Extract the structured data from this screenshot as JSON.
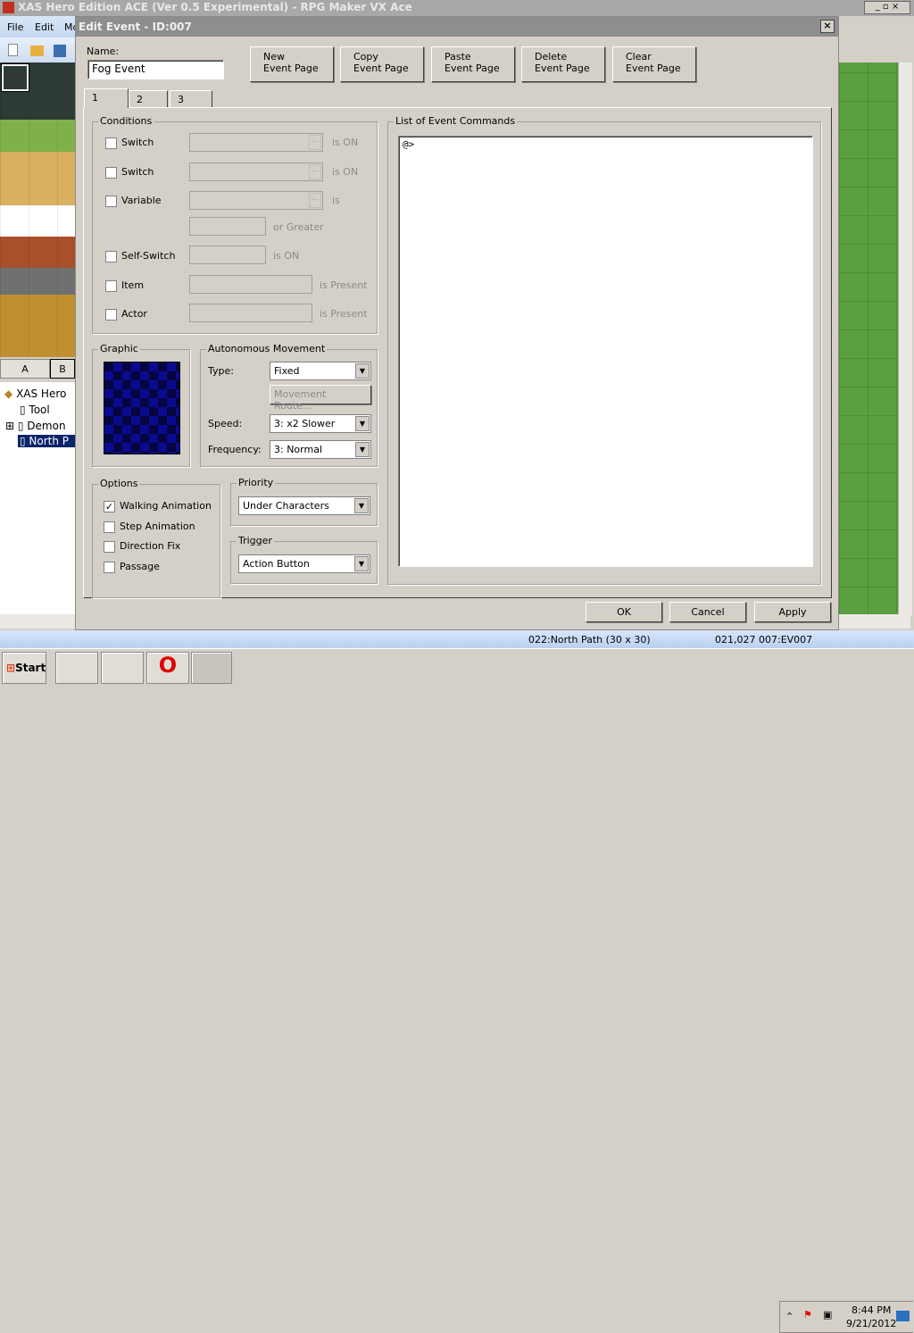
{
  "app": {
    "title": "XAS Hero Edition ACE (Ver 0.5 Experimental) - RPG Maker VX Ace",
    "menu": [
      "File",
      "Edit",
      "Mo"
    ]
  },
  "palette_tabs": [
    "A",
    "B"
  ],
  "tree": [
    "XAS Hero",
    "Tool",
    "Demon",
    "North P"
  ],
  "status": {
    "map": "022:North Path (30 x 30)",
    "coords": "021,027",
    "event": "007:EV007"
  },
  "taskbar": {
    "start": "Start",
    "time": "8:44 PM",
    "date": "9/21/2012"
  },
  "dialog": {
    "title": "Edit Event - ID:007",
    "close": "×",
    "name_label": "Name:",
    "name_value": "Fog Event",
    "buttons": [
      "New\nEvent Page",
      "Copy\nEvent Page",
      "Paste\nEvent Page",
      "Delete\nEvent Page",
      "Clear\nEvent Page"
    ],
    "tabs": [
      "1",
      "2",
      "3"
    ],
    "conditions": {
      "label": "Conditions",
      "switch1": "Switch",
      "switch2": "Switch",
      "variable": "Variable",
      "self_switch": "Self-Switch",
      "item": "Item",
      "actor": "Actor",
      "is_on": "is ON",
      "is": "is",
      "or_greater": "or Greater",
      "is_present": "is Present",
      "ellipsis": "..."
    },
    "graphic": {
      "label": "Graphic"
    },
    "movement": {
      "label": "Autonomous Movement",
      "type_label": "Type:",
      "type": "Fixed",
      "route": "Movement Route...",
      "speed_label": "Speed:",
      "speed": "3: x2 Slower",
      "freq_label": "Frequency:",
      "freq": "3: Normal"
    },
    "options": {
      "label": "Options",
      "items": [
        {
          "label": "Walking Animation",
          "checked": true
        },
        {
          "label": "Step Animation",
          "checked": false
        },
        {
          "label": "Direction Fix",
          "checked": false
        },
        {
          "label": "Passage",
          "checked": false
        }
      ]
    },
    "priority": {
      "label": "Priority",
      "value": "Under Characters"
    },
    "trigger": {
      "label": "Trigger",
      "value": "Action Button"
    },
    "commands": {
      "label": "List of Event Commands",
      "lines": [
        "@>"
      ]
    },
    "ok": "OK",
    "cancel": "Cancel",
    "apply": "Apply"
  }
}
